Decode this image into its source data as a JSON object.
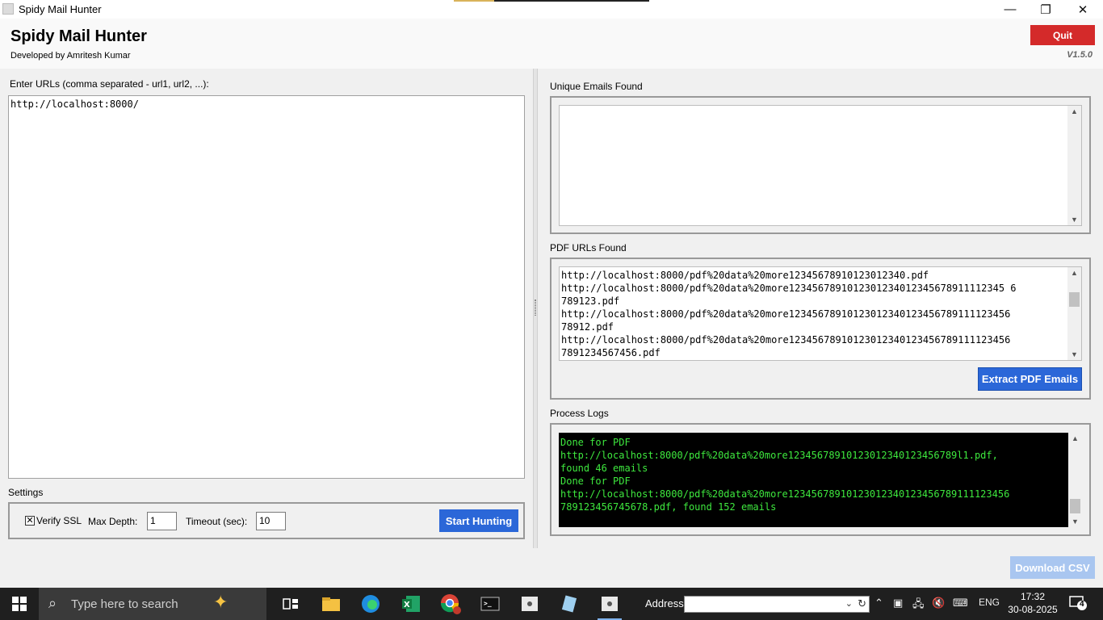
{
  "window": {
    "title": "Spidy Mail Hunter",
    "minimize_glyph": "—",
    "restore_glyph": "❐",
    "close_glyph": "✕"
  },
  "header": {
    "title": "Spidy Mail Hunter",
    "subtitle": "Developed by Amritesh Kumar",
    "quit_label": "Quit",
    "version": "V1.5.0"
  },
  "left": {
    "url_label": "Enter URLs (comma separated - url1, url2, ...):",
    "url_value": "http://localhost:8000/",
    "settings_label": "Settings",
    "verify_ssl_label": "Verify SSL",
    "verify_ssl_checked": true,
    "max_depth_label": "Max Depth:",
    "max_depth_value": "1",
    "timeout_label": "Timeout (sec):",
    "timeout_value": "10",
    "start_label": "Start Hunting"
  },
  "right": {
    "emails_label": "Unique Emails Found",
    "emails": [],
    "pdf_label": "PDF URLs Found",
    "pdf_text": "http://localhost:8000/pdf%20data%20more12345678910123012340.pdf\nhttp://localhost:8000/pdf%20data%20more1234567891012301234012345678911112345 6\n789123.pdf\nhttp://localhost:8000/pdf%20data%20more12345678910123012340123456789111123456\n78912.pdf\nhttp://localhost:8000/pdf%20data%20more12345678910123012340123456789111123456\n7891234567456.pdf",
    "extract_label": "Extract PDF Emails",
    "logs_label": "Process Logs",
    "logs_text": "Done for PDF\nhttp://localhost:8000/pdf%20data%20more12345678910123012340123456789l1.pdf,\nfound 46 emails\nDone for PDF\nhttp://localhost:8000/pdf%20data%20more12345678910123012340123456789111123456\n789123456745678.pdf, found 152 emails"
  },
  "bottom": {
    "download_label": "Download CSV"
  },
  "taskbar": {
    "search_placeholder": "Type here to search",
    "address_label": "Address",
    "address_value": "",
    "language": "ENG",
    "time": "17:32",
    "date": "30-08-2025",
    "notification_count": "4",
    "icons": [
      "windows-start-icon",
      "search-icon",
      "copilot-icon",
      "task-view-icon",
      "file-explorer-icon",
      "edge-icon",
      "excel-icon",
      "chrome-icon",
      "terminal-icon",
      "spidy-app-icon",
      "notepad-icon",
      "spidy-app-active-icon"
    ]
  },
  "colors": {
    "quit": "#d42a2a",
    "primary_button": "#2b67d8",
    "disabled_button": "#a9c6f0",
    "log_text": "#3ee83e",
    "log_bg": "#000000"
  }
}
